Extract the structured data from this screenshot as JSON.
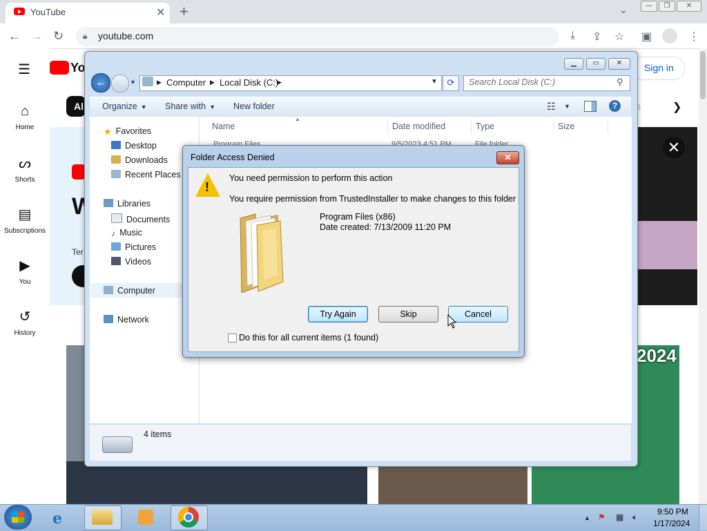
{
  "browser": {
    "tab_title": "YouTube",
    "tab_close": "✕",
    "new_tab": "+",
    "url": "youtube.com",
    "tab_search": "⌄"
  },
  "youtube": {
    "sidebar": [
      {
        "label": "Home",
        "icon": "home-icon"
      },
      {
        "label": "Shorts",
        "icon": "shorts-icon"
      },
      {
        "label": "Subscriptions",
        "icon": "subscriptions-icon"
      },
      {
        "label": "You",
        "icon": "you-icon"
      },
      {
        "label": "History",
        "icon": "history-icon"
      }
    ],
    "logo_text": "Yo",
    "chip_text": "Al",
    "sign_in": "Sign in",
    "thumb_text_2024": "2024",
    "banner_letter": "W",
    "banner_small": "Ter",
    "right_chip_text": "s"
  },
  "explorer": {
    "breadcrumb": [
      "Computer",
      "Local Disk (C:)"
    ],
    "search_placeholder": "Search Local Disk (C:)",
    "commands": {
      "organize": "Organize",
      "share": "Share with",
      "new_folder": "New folder"
    },
    "nav": {
      "favorites": "Favorites",
      "favorites_items": [
        "Desktop",
        "Downloads",
        "Recent Places"
      ],
      "libraries": "Libraries",
      "libraries_items": [
        "Documents",
        "Music",
        "Pictures",
        "Videos"
      ],
      "computer": "Computer",
      "network": "Network"
    },
    "columns": [
      "Name",
      "Date modified",
      "Type",
      "Size"
    ],
    "partial_row": {
      "name": "Program Files",
      "date": "9/5/2023 4:51 PM",
      "type": "File folder"
    },
    "status": "4 items"
  },
  "dialog": {
    "title": "Folder Access Denied",
    "close": "✕",
    "message_primary": "You need permission to perform this action",
    "message_secondary": "You require permission from TrustedInstaller to make changes to this folder",
    "item_name": "Program Files (x86)",
    "item_date": "Date created: 7/13/2009 11:20 PM",
    "buttons": {
      "try_again": "Try Again",
      "skip": "Skip",
      "cancel": "Cancel"
    },
    "checkbox_label": "Do this for all current items (1 found)",
    "checkbox_checked": false
  },
  "taskbar": {
    "time": "9:50 PM",
    "date": "1/17/2024",
    "tray_arrow": "▲",
    "apps": [
      "internet-explorer",
      "windows-explorer",
      "windows-media-center",
      "google-chrome"
    ]
  },
  "colors": {
    "youtube_red": "#ff0000",
    "chrome_tabbar": "#dee1e6",
    "win7_title": "#b9d1ea",
    "dialog_close_red": "#c6442c",
    "taskbar": "#9ab9da"
  }
}
